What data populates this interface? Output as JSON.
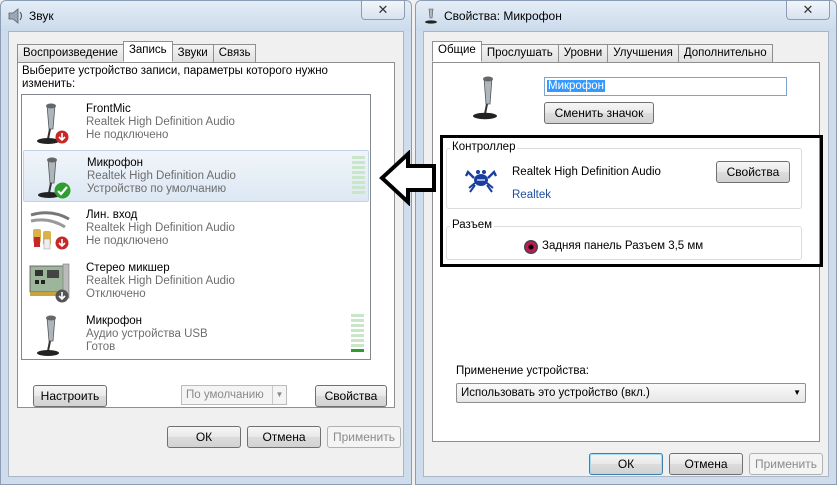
{
  "sound_window": {
    "title": "Звук",
    "close_glyph": "✕",
    "tabs": [
      "Воспроизведение",
      "Запись",
      "Звуки",
      "Связь"
    ],
    "active_tab": "Запись",
    "description": "Выберите устройство записи, параметры которого нужно изменить:",
    "devices": [
      {
        "name": "FrontMic",
        "driver": "Realtek High Definition Audio",
        "status": "Не подключено",
        "icon": "microphone-icon",
        "badge": "disconnected-arrow-icon",
        "meter_level": 0
      },
      {
        "name": "Микрофон",
        "driver": "Realtek High Definition Audio",
        "status": "Устройство по умолчанию",
        "icon": "microphone-icon",
        "badge": "default-check-icon",
        "meter_level": 0,
        "selected": true
      },
      {
        "name": "Лин. вход",
        "driver": "Realtek High Definition Audio",
        "status": "Не подключено",
        "icon": "line-in-cable-icon",
        "badge": "disconnected-arrow-icon",
        "meter_level": 0
      },
      {
        "name": "Стерео микшер",
        "driver": "Realtek High Definition Audio",
        "status": "Отключено",
        "icon": "sound-card-icon",
        "badge": "disabled-arrow-icon",
        "meter_level": 0
      },
      {
        "name": "Микрофон",
        "driver": "Аудио устройства USB",
        "status": "Готов",
        "icon": "microphone-icon",
        "meter_level": 0.1
      }
    ],
    "configure_label": "Настроить",
    "default_combo_label": "По умолчанию",
    "properties_label": "Свойства",
    "ok_label": "ОК",
    "cancel_label": "Отмена",
    "apply_label": "Применить"
  },
  "mic_properties_window": {
    "title": "Свойства: Микрофон",
    "close_glyph": "✕",
    "tabs": [
      "Общие",
      "Прослушать",
      "Уровни",
      "Улучшения",
      "Дополнительно"
    ],
    "active_tab": "Общие",
    "device_name_value": "Микрофон",
    "change_icon_label": "Сменить значок",
    "controller_group_label": "Контроллер",
    "controller_name": "Realtek High Definition Audio",
    "controller_vendor": "Realtek",
    "controller_properties_label": "Свойства",
    "jack_group_label": "Разъем",
    "jack_description": "Задняя панель Разъем 3,5 мм",
    "device_usage_label": "Применение устройства:",
    "device_usage_value": "Использовать это устройство (вкл.)",
    "ok_label": "ОК",
    "cancel_label": "Отмена",
    "apply_label": "Применить"
  },
  "colors": {
    "highlight_border": "#000000",
    "link": "#1f4fa0",
    "jack": "#c2185b",
    "meter_on": "#2ca02c"
  }
}
